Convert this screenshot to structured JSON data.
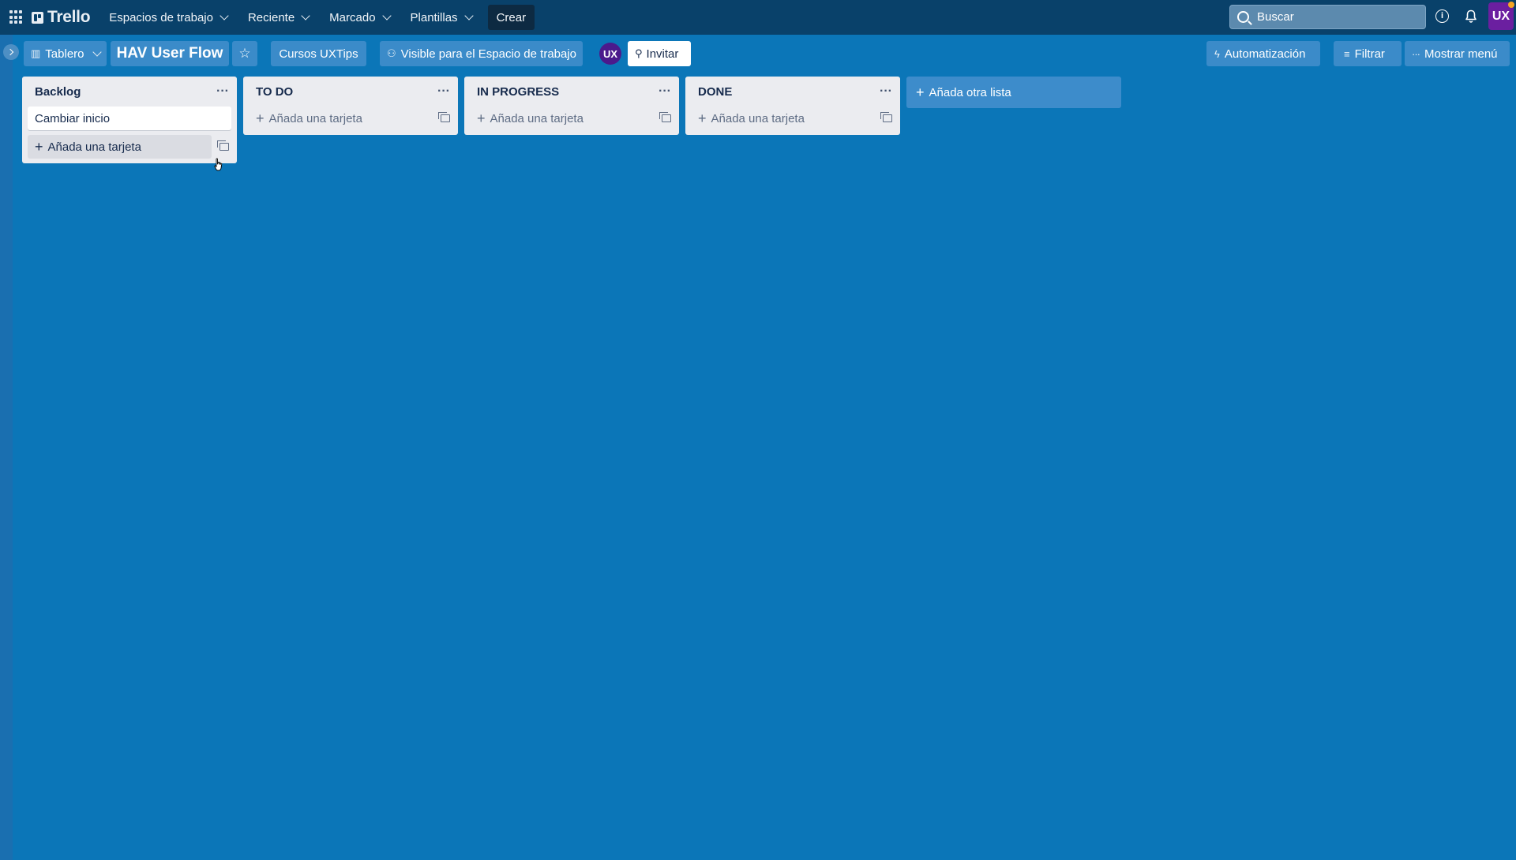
{
  "header": {
    "logo": "Trello",
    "nav": [
      {
        "label": "Espacios de trabajo"
      },
      {
        "label": "Reciente"
      },
      {
        "label": "Marcado"
      },
      {
        "label": "Plantillas"
      }
    ],
    "create_label": "Crear",
    "search_placeholder": "Buscar",
    "avatar_initials": "UX"
  },
  "board": {
    "view_label": "Tablero",
    "title": "HAV User Flow",
    "workspace": "Cursos UXTips",
    "visibility": "Visible para el Espacio de trabajo",
    "member_initials": "UX",
    "invite_label": "Invitar",
    "automation_label": "Automatización",
    "filter_label": "Filtrar",
    "menu_label": "Mostrar menú"
  },
  "lists": [
    {
      "title": "Backlog",
      "cards": [
        "Cambiar inicio"
      ],
      "add_label": "Añada una tarjeta"
    },
    {
      "title": "TO DO",
      "cards": [],
      "add_label": "Añada una tarjeta"
    },
    {
      "title": "IN PROGRESS",
      "cards": [],
      "add_label": "Añada una tarjeta"
    },
    {
      "title": "DONE",
      "cards": [],
      "add_label": "Añada una tarjeta"
    }
  ],
  "add_list_label": "Añada otra lista",
  "colors": {
    "header_bg": "#09416a",
    "board_bg": "#0b76b8",
    "list_bg": "#ebecf0"
  }
}
